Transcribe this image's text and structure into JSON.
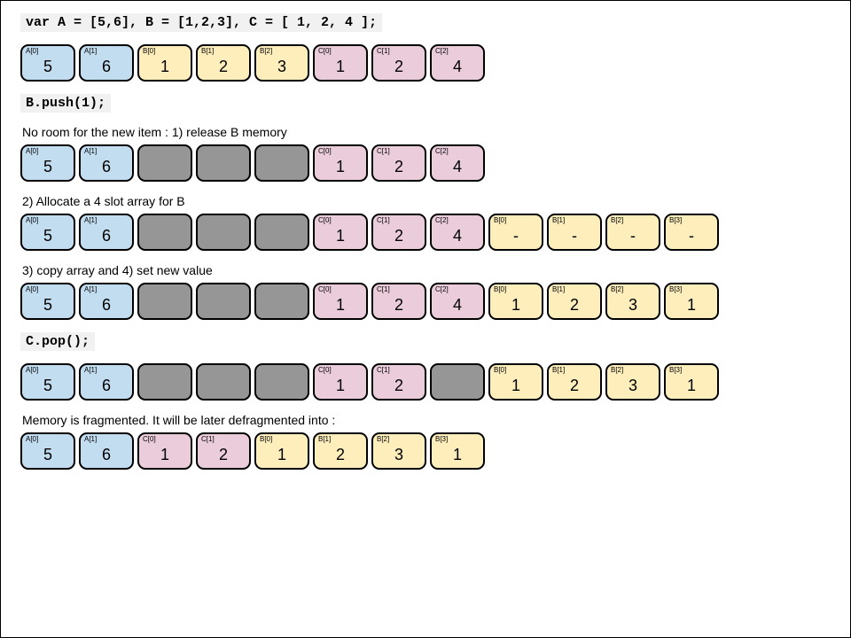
{
  "colors": {
    "A": "#c2dcf0",
    "B": "#fdeebc",
    "C": "#eaccda",
    "gray": "#969696"
  },
  "line_decl": "var A = [5,6],  B = [1,2,3], C = [ 1, 2, 4 ];",
  "row1": [
    {
      "label": "A[0]",
      "value": "5",
      "cls": "c-a"
    },
    {
      "label": "A[1]",
      "value": "6",
      "cls": "c-a"
    },
    {
      "label": "B[0]",
      "value": "1",
      "cls": "c-b"
    },
    {
      "label": "B[1]",
      "value": "2",
      "cls": "c-b"
    },
    {
      "label": "B[2]",
      "value": "3",
      "cls": "c-b"
    },
    {
      "label": "C[0]",
      "value": "1",
      "cls": "c-c"
    },
    {
      "label": "C[1]",
      "value": "2",
      "cls": "c-c"
    },
    {
      "label": "C[2]",
      "value": "4",
      "cls": "c-c"
    }
  ],
  "line_push": "B.push(1);",
  "cap_release": "No room for the new item : 1) release B memory",
  "row2": [
    {
      "label": "A[0]",
      "value": "5",
      "cls": "c-a"
    },
    {
      "label": "A[1]",
      "value": "6",
      "cls": "c-a"
    },
    {
      "label": "",
      "value": "",
      "cls": "c-gray"
    },
    {
      "label": "",
      "value": "",
      "cls": "c-gray"
    },
    {
      "label": "",
      "value": "",
      "cls": "c-gray"
    },
    {
      "label": "C[0]",
      "value": "1",
      "cls": "c-c"
    },
    {
      "label": "C[1]",
      "value": "2",
      "cls": "c-c"
    },
    {
      "label": "C[2]",
      "value": "4",
      "cls": "c-c"
    }
  ],
  "cap_alloc": "2) Allocate a 4 slot array for B",
  "row3": [
    {
      "label": "A[0]",
      "value": "5",
      "cls": "c-a"
    },
    {
      "label": "A[1]",
      "value": "6",
      "cls": "c-a"
    },
    {
      "label": "",
      "value": "",
      "cls": "c-gray"
    },
    {
      "label": "",
      "value": "",
      "cls": "c-gray"
    },
    {
      "label": "",
      "value": "",
      "cls": "c-gray"
    },
    {
      "label": "C[0]",
      "value": "1",
      "cls": "c-c"
    },
    {
      "label": "C[1]",
      "value": "2",
      "cls": "c-c"
    },
    {
      "label": "C[2]",
      "value": "4",
      "cls": "c-c"
    },
    {
      "label": "B[0]",
      "value": "-",
      "cls": "c-b"
    },
    {
      "label": "B[1]",
      "value": "-",
      "cls": "c-b"
    },
    {
      "label": "B[2]",
      "value": "-",
      "cls": "c-b"
    },
    {
      "label": "B[3]",
      "value": "-",
      "cls": "c-b"
    }
  ],
  "cap_copy": "3) copy array and 4) set new value",
  "row4": [
    {
      "label": "A[0]",
      "value": "5",
      "cls": "c-a"
    },
    {
      "label": "A[1]",
      "value": "6",
      "cls": "c-a"
    },
    {
      "label": "",
      "value": "",
      "cls": "c-gray"
    },
    {
      "label": "",
      "value": "",
      "cls": "c-gray"
    },
    {
      "label": "",
      "value": "",
      "cls": "c-gray"
    },
    {
      "label": "C[0]",
      "value": "1",
      "cls": "c-c"
    },
    {
      "label": "C[1]",
      "value": "2",
      "cls": "c-c"
    },
    {
      "label": "C[2]",
      "value": "4",
      "cls": "c-c"
    },
    {
      "label": "B[0]",
      "value": "1",
      "cls": "c-b"
    },
    {
      "label": "B[1]",
      "value": "2",
      "cls": "c-b"
    },
    {
      "label": "B[2]",
      "value": "3",
      "cls": "c-b"
    },
    {
      "label": "B[3]",
      "value": "1",
      "cls": "c-b"
    }
  ],
  "line_pop": "C.pop();",
  "row5": [
    {
      "label": "A[0]",
      "value": "5",
      "cls": "c-a"
    },
    {
      "label": "A[1]",
      "value": "6",
      "cls": "c-a"
    },
    {
      "label": "",
      "value": "",
      "cls": "c-gray"
    },
    {
      "label": "",
      "value": "",
      "cls": "c-gray"
    },
    {
      "label": "",
      "value": "",
      "cls": "c-gray"
    },
    {
      "label": "C[0]",
      "value": "1",
      "cls": "c-c"
    },
    {
      "label": "C[1]",
      "value": "2",
      "cls": "c-c"
    },
    {
      "label": "",
      "value": "",
      "cls": "c-gray"
    },
    {
      "label": "B[0]",
      "value": "1",
      "cls": "c-b"
    },
    {
      "label": "B[1]",
      "value": "2",
      "cls": "c-b"
    },
    {
      "label": "B[2]",
      "value": "3",
      "cls": "c-b"
    },
    {
      "label": "B[3]",
      "value": "1",
      "cls": "c-b"
    }
  ],
  "cap_frag": "Memory is fragmented. It will be later defragmented into :",
  "row6": [
    {
      "label": "A[0]",
      "value": "5",
      "cls": "c-a"
    },
    {
      "label": "A[1]",
      "value": "6",
      "cls": "c-a"
    },
    {
      "label": "C[0]",
      "value": "1",
      "cls": "c-c"
    },
    {
      "label": "C[1]",
      "value": "2",
      "cls": "c-c"
    },
    {
      "label": "B[0]",
      "value": "1",
      "cls": "c-b"
    },
    {
      "label": "B[1]",
      "value": "2",
      "cls": "c-b"
    },
    {
      "label": "B[2]",
      "value": "3",
      "cls": "c-b"
    },
    {
      "label": "B[3]",
      "value": "1",
      "cls": "c-b"
    }
  ]
}
